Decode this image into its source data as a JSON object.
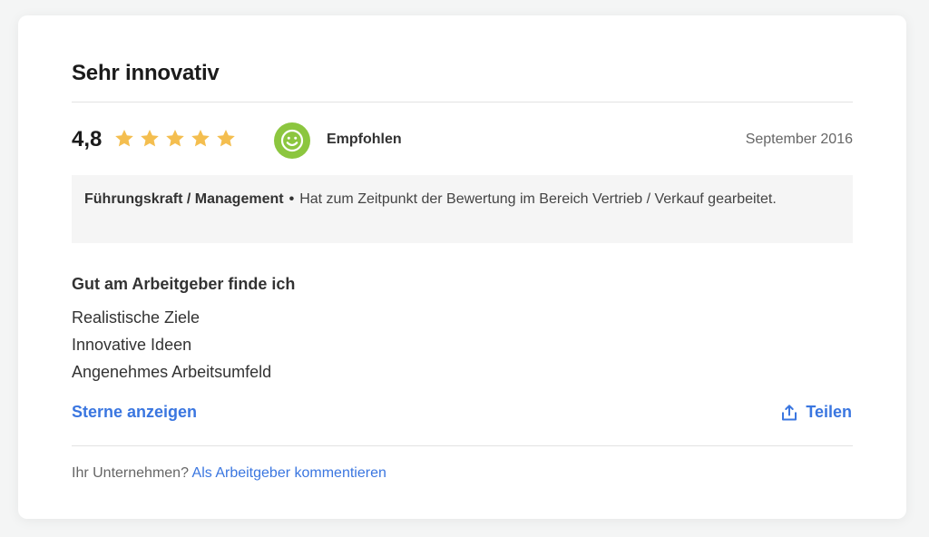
{
  "review": {
    "title": "Sehr innovativ",
    "score": "4,8",
    "stars_filled": 5,
    "stars_total": 5,
    "recommendation_label": "Empfohlen",
    "date": "September 2016",
    "role": "Führungskraft / Management",
    "bullet": "•",
    "role_detail": "Hat zum Zeitpunkt der Bewertung im Bereich Vertrieb / Verkauf gearbeitet.",
    "pros_heading": "Gut am Arbeitgeber finde ich",
    "pros": [
      "Realistische Ziele",
      "Innovative Ideen",
      "Angenehmes Arbeitsumfeld"
    ],
    "show_stars_label": "Sterne anzeigen",
    "share_label": "Teilen",
    "share_icon": "share-icon",
    "footer_text": "Ihr Unternehmen?",
    "footer_link": "Als Arbeitgeber kommentieren"
  },
  "colors": {
    "star": "#f4be4f",
    "recommend": "#8cc63f",
    "link": "#3a76e0",
    "info_bg": "#f5f5f5"
  }
}
